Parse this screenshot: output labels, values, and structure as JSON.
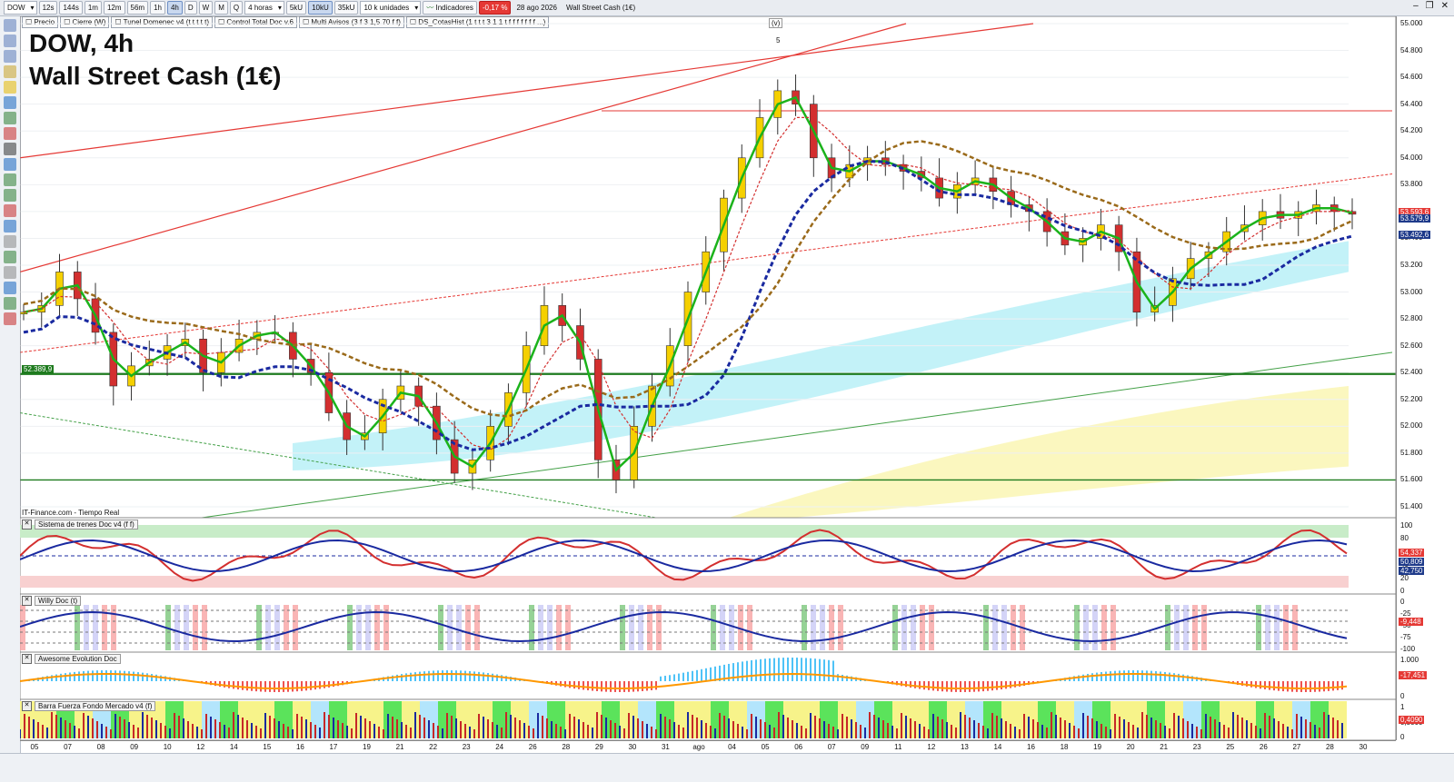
{
  "toolbar": {
    "symbol": "DOW",
    "timeframes": [
      "12s",
      "144s",
      "1m",
      "12m",
      "56m",
      "1h",
      "4h",
      "D",
      "W",
      "M",
      "Q"
    ],
    "active_timeframe": "4h",
    "period": "4 horas",
    "volume_buttons": [
      "5kU",
      "10kU",
      "35kU"
    ],
    "active_volume": "10kU",
    "units": "10 k unidades",
    "indicators_label": "Indicadores",
    "change": "-0,17 %",
    "change_color": "#e53935",
    "date": "28 ago 2026",
    "instrument": "Wall Street Cash (1€)"
  },
  "legend": [
    "Precio",
    "Cierre (W)",
    "Tunel Domenec v4 (t t t t t)",
    "Control Total Doc v.6",
    "Multi Avisos (3 f 3 1,5 70 f f)",
    "DS_CotasHist (1 t t t 3 1 1 t f f f f f f f ...)"
  ],
  "title": {
    "line1": "DOW, 4h",
    "line2": "Wall Street Cash (1€)"
  },
  "source": "IT-Finance.com - Tiempo Real",
  "wave_label": "(v)",
  "wave_number": "5",
  "hline_label": "52.389,9",
  "price_axis": [
    "55.000",
    "54.800",
    "54.600",
    "54.400",
    "54.200",
    "54.000",
    "53.800",
    "53.600",
    "53.400",
    "53.200",
    "53.000",
    "52.800",
    "52.600",
    "52.400",
    "52.200",
    "52.000",
    "51.800",
    "51.600",
    "51.400"
  ],
  "price_tags": [
    {
      "text": "53.593,6",
      "color": "#e53935"
    },
    {
      "text": "53.579,9",
      "color": "#1e3a8a"
    },
    {
      "text": "53.492,6",
      "color": "#1e3a8a"
    }
  ],
  "panes": [
    {
      "name": "Sistema de trenes Doc v4 (f f)",
      "axis": [
        "100",
        "80",
        "60",
        "40",
        "20",
        "0"
      ],
      "tags": [
        "54,337",
        "50,809",
        "42,750"
      ]
    },
    {
      "name": "Willy Doc (t)",
      "axis": [
        "0",
        "-25",
        "-50",
        "-75",
        "-100"
      ],
      "tags": [
        "-9,448"
      ]
    },
    {
      "name": "Awesome Evolution Doc",
      "axis": [
        "1.000",
        "0"
      ],
      "tags": [
        "-17,451"
      ]
    },
    {
      "name": "Barra Fuerza Fondo Mercado v4 (f)",
      "axis": [
        "1",
        "0,5000",
        "0"
      ],
      "tags": [
        "0,4090"
      ]
    }
  ],
  "x_axis": [
    "05",
    "07",
    "08",
    "09",
    "10",
    "12",
    "14",
    "15",
    "16",
    "17",
    "19",
    "21",
    "22",
    "23",
    "24",
    "26",
    "28",
    "29",
    "30",
    "31",
    "ago",
    "04",
    "05",
    "06",
    "07",
    "09",
    "11",
    "12",
    "13",
    "14",
    "16",
    "18",
    "19",
    "20",
    "21",
    "23",
    "25",
    "26",
    "27",
    "28",
    "30"
  ],
  "chart_data": {
    "type": "candlestick",
    "title": "DOW, 4h",
    "subtitle": "Wall Street Cash (1€)",
    "ylim": [
      51400,
      55000
    ],
    "close_path": [
      52850,
      52900,
      53150,
      52950,
      52700,
      52300,
      52450,
      52500,
      52600,
      52650,
      52400,
      52550,
      52650,
      52700,
      52700,
      52500,
      52400,
      52100,
      51900,
      51950,
      52200,
      52300,
      52150,
      51900,
      51650,
      51750,
      52000,
      52250,
      52600,
      52900,
      52750,
      52500,
      51750,
      51600,
      52000,
      52300,
      52600,
      53000,
      53300,
      53700,
      54000,
      54300,
      54500,
      54400,
      54000,
      53850,
      53950,
      54000,
      53950,
      53900,
      53850,
      53700,
      53800,
      53850,
      53750,
      53650,
      53600,
      53450,
      53350,
      53400,
      53500,
      53300,
      52850,
      52900,
      53100,
      53250,
      53300,
      53450,
      53500,
      53600,
      53550,
      53600,
      53650,
      53600,
      53580
    ],
    "horizontal_levels": [
      52389.9,
      51600
    ]
  }
}
